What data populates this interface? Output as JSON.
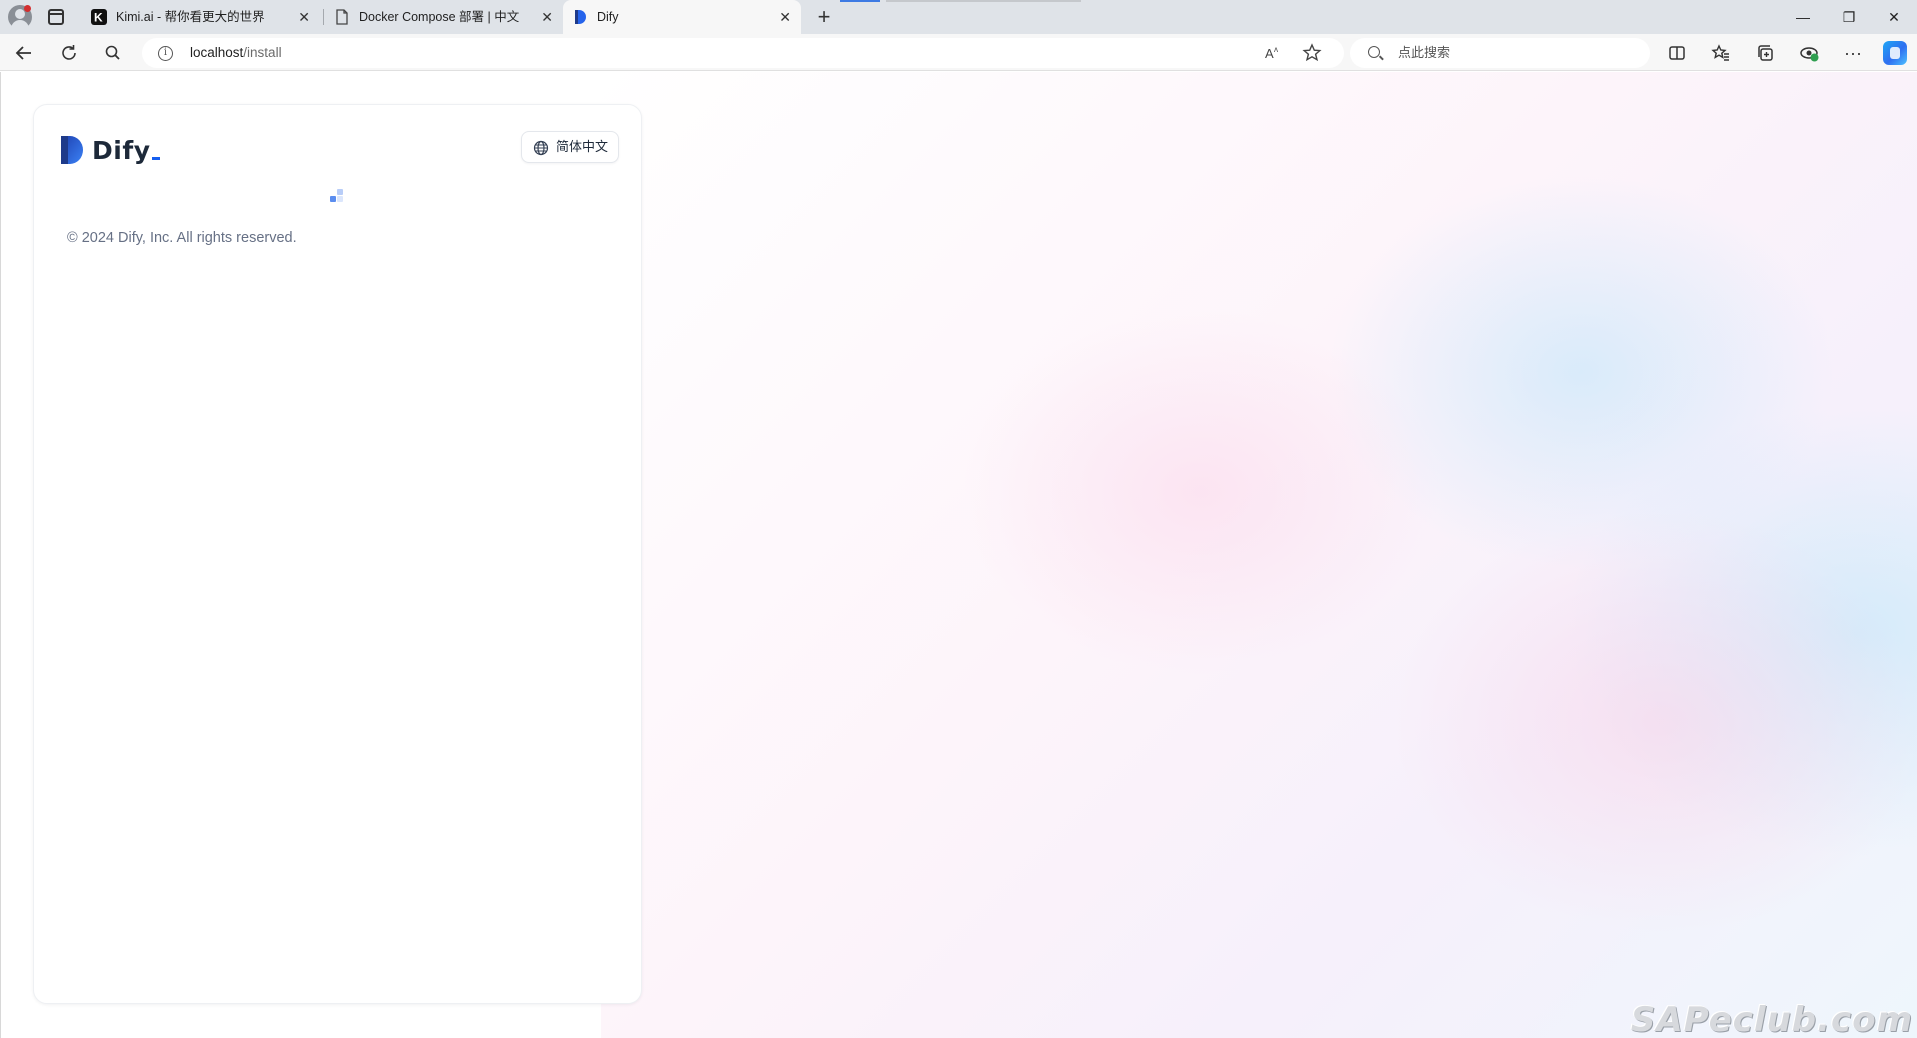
{
  "browser": {
    "tabs": [
      {
        "title": "Kimi.ai - 帮你看更大的世界",
        "active": false
      },
      {
        "title": "Docker Compose 部署 | 中文",
        "active": false
      },
      {
        "title": "Dify",
        "active": true
      }
    ],
    "close_glyph": "✕",
    "new_tab_glyph": "+",
    "window_controls": {
      "minimize": "—",
      "restore": "❐",
      "close": "✕"
    },
    "url": {
      "host": "localhost",
      "path": "/install"
    },
    "search_placeholder": "点此搜索",
    "accent": "#3d7ae3"
  },
  "page": {
    "logo_text": "Dify",
    "language_button": "简体中文",
    "copyright": "© 2024 Dify, Inc. All rights reserved.",
    "watermark": "SAPeclub.com",
    "brand_color": "#155eef"
  }
}
